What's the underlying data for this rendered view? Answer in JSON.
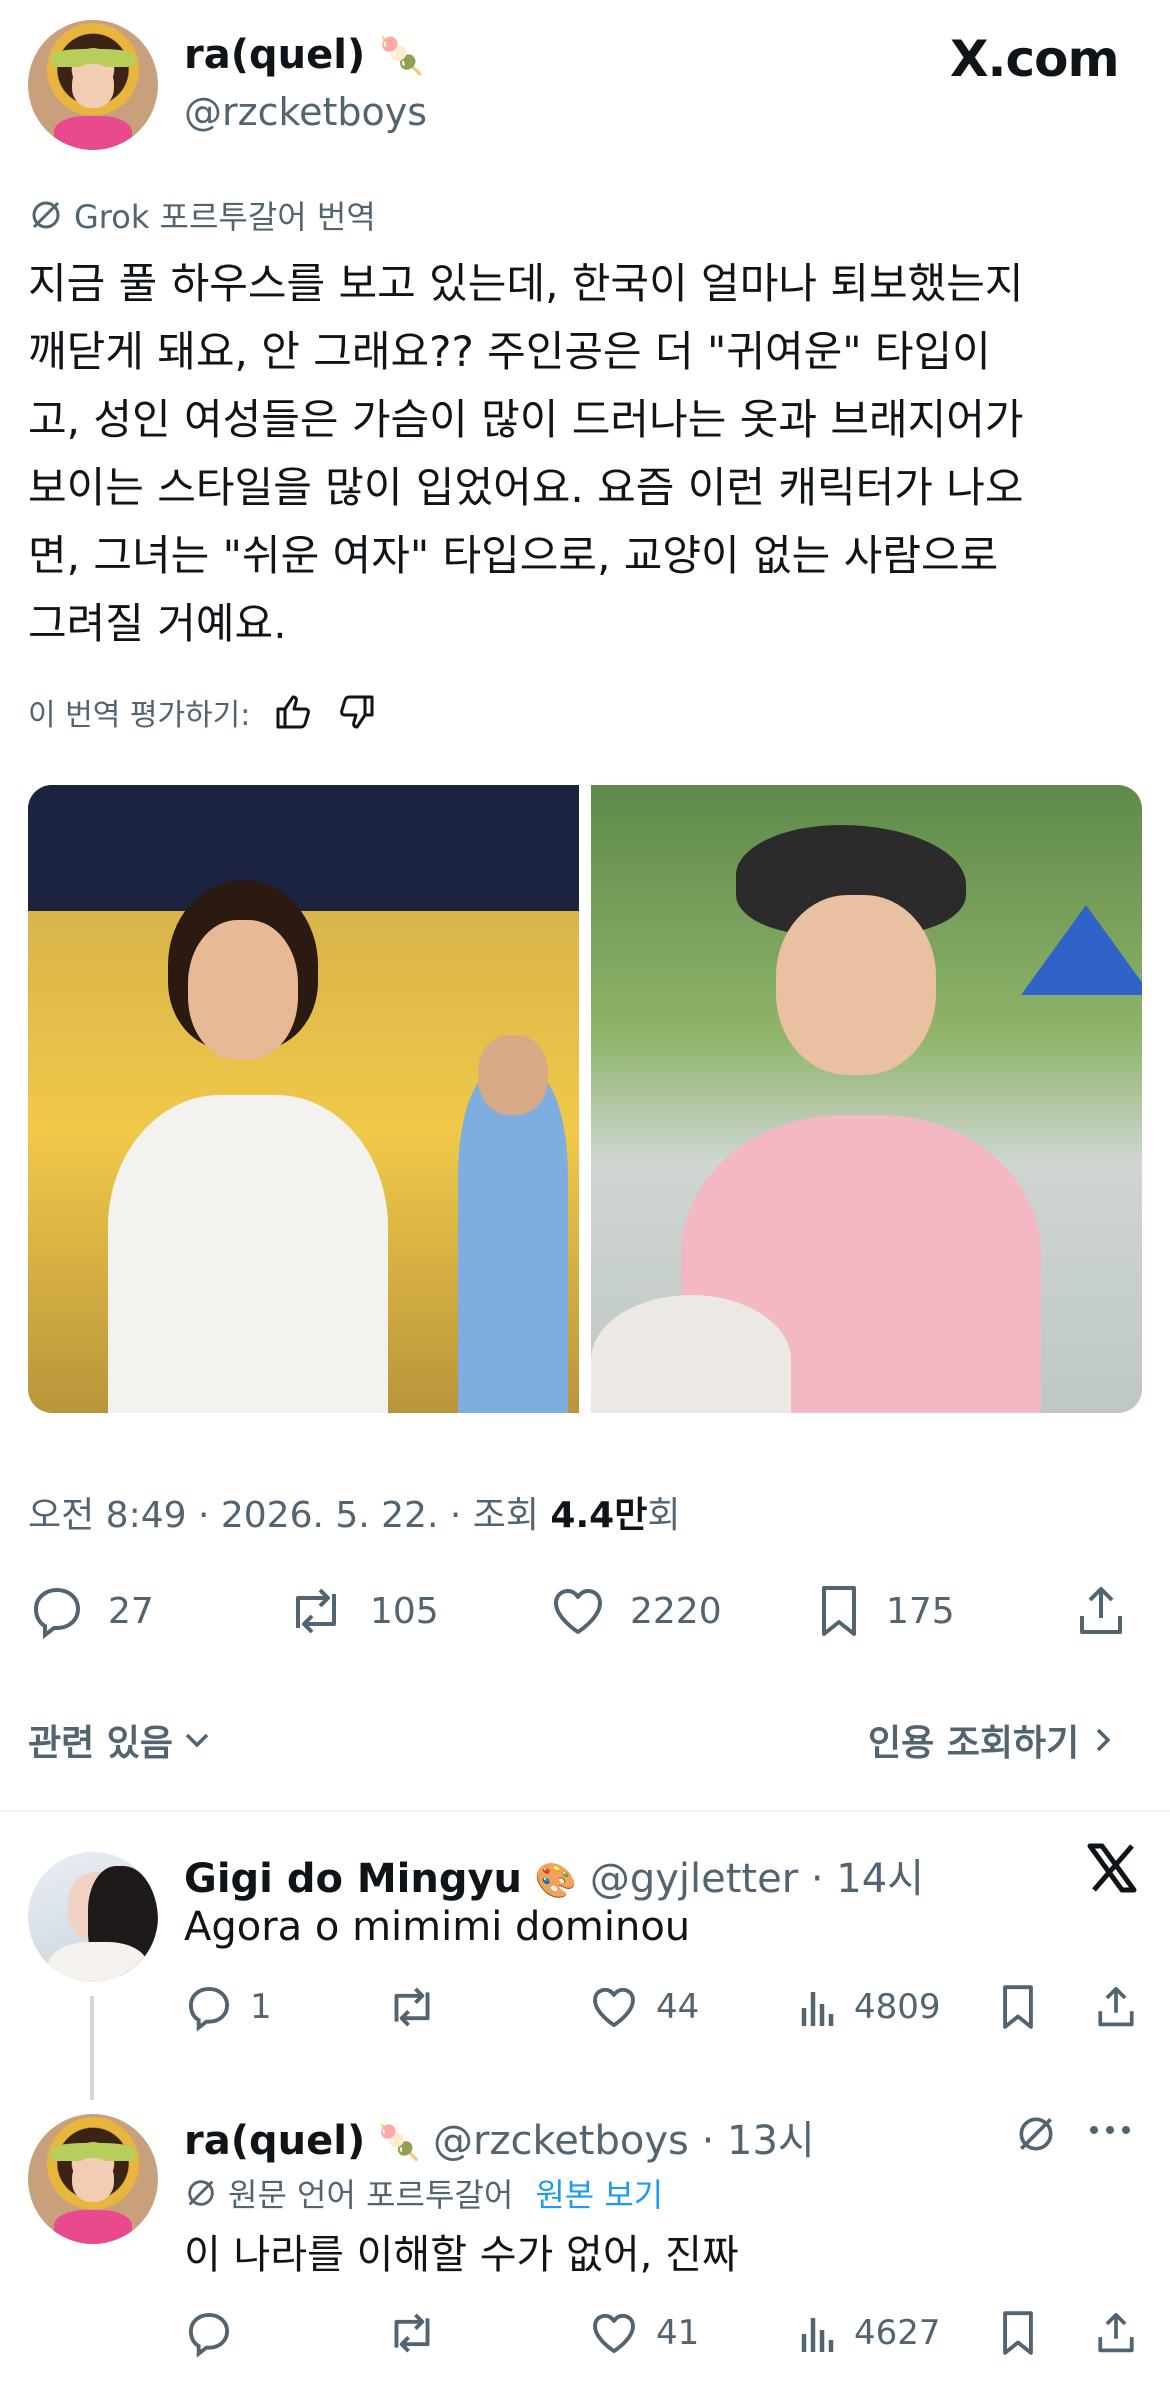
{
  "post": {
    "author_name": "ra(quel)",
    "author_emoji": "🍡",
    "author_handle": "@rzcketboys",
    "site_logo": "X.com",
    "translation_note": "Grok 포르투갈어 번역",
    "body_lines": [
      "지금 풀 하우스를 보고 있는데, 한국이 얼마나 퇴보했는지",
      "깨닫게 돼요, 안 그래요?? 주인공은 더 \"귀여운\" 타입이",
      "고, 성인 여성들은 가슴이 많이 드러나는 옷과 브래지어가",
      "보이는 스타일을 많이 입었어요. 요즘 이런 캐릭터가 나오",
      "면, 그녀는 \"쉬운 여자\" 타입으로, 교양이 없는 사람으로",
      "그려질 거예요."
    ],
    "rate_label": "이 번역 평가하기:",
    "meta_time": "오전 8:49 · 2026. 5. 22. · 조회 ",
    "meta_views": "4.4만",
    "meta_views_suffix": "회",
    "stats": {
      "replies": "27",
      "reposts": "105",
      "likes": "2220",
      "bookmarks": "175"
    },
    "related_label": "관련 있음",
    "quote_label": "인용 조회하기"
  },
  "replies": [
    {
      "name": "Gigi do Mingyu",
      "emoji": "🎨",
      "handle": "@gyjletter",
      "time": "· 14시",
      "text": "Agora o mimimi dominou",
      "stats": {
        "replies": "1",
        "reposts": "",
        "likes": "44",
        "views": "4809"
      }
    },
    {
      "name": "ra(quel)",
      "emoji": "🍡",
      "handle": "@rzcketboys",
      "time": "· 13시",
      "lang_note": "원문 언어 포르투갈어",
      "view_original": "원본 보기",
      "text": "이 나라를 이해할 수가 없어, 진짜",
      "stats": {
        "replies": "",
        "reposts": "",
        "likes": "41",
        "views": "4627"
      }
    }
  ],
  "colors": {
    "text": "#0f1419",
    "secondary": "#536471",
    "link": "#1d9bf0",
    "divider": "#eff3f4"
  }
}
